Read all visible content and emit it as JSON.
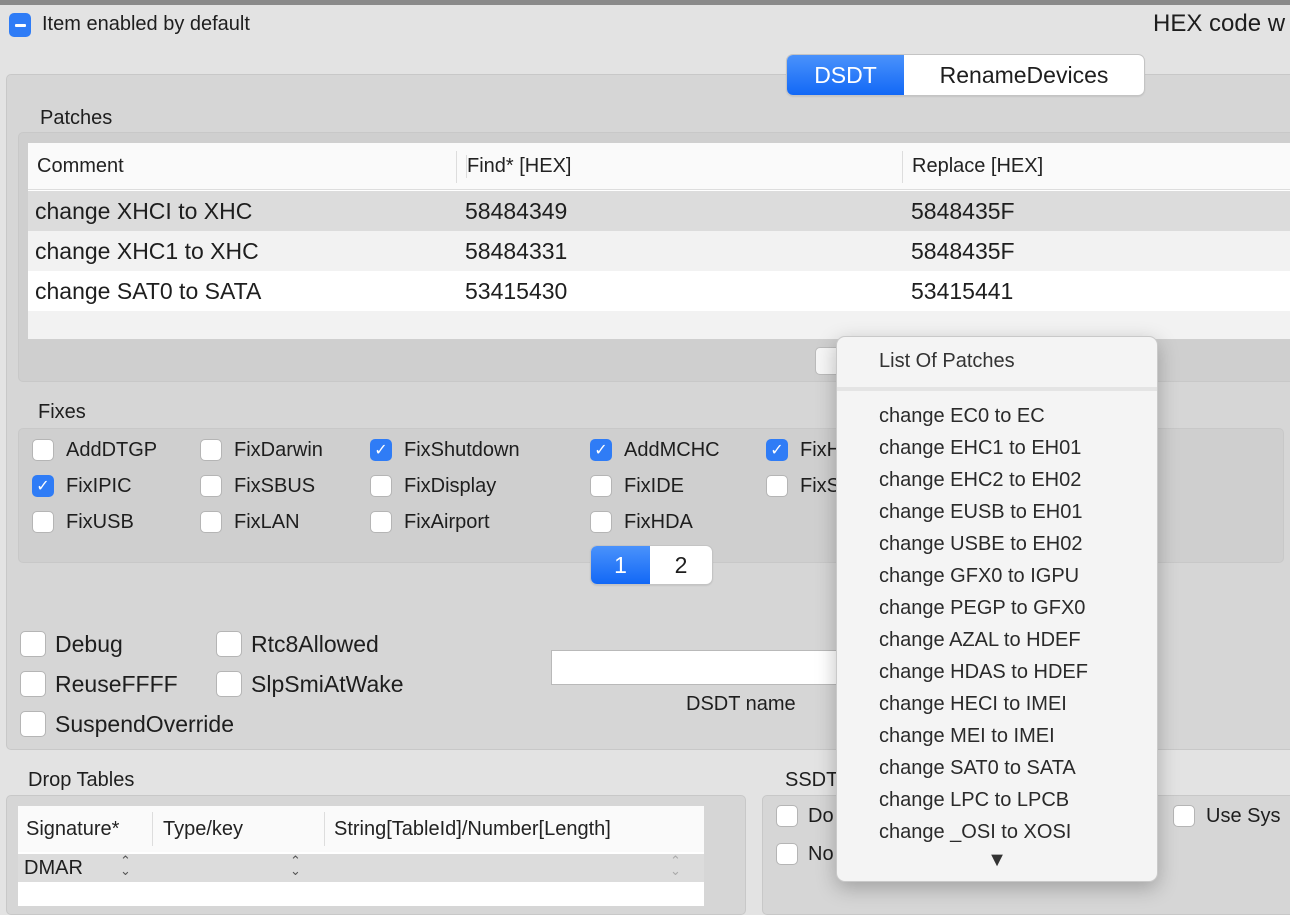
{
  "header": {
    "item_enabled_label": "Item enabled by default",
    "hex_code_label": "HEX code w"
  },
  "tabs": [
    {
      "label": "DSDT",
      "selected": true
    },
    {
      "label": "RenameDevices",
      "selected": false
    }
  ],
  "patches": {
    "title": "Patches",
    "columns": [
      "Comment",
      "Find* [HEX]",
      "Replace [HEX]"
    ],
    "rows": [
      {
        "comment": "change XHCI to XHC",
        "find": "58484349",
        "replace": "5848435F"
      },
      {
        "comment": "change XHC1 to XHC",
        "find": "58484331",
        "replace": "5848435F"
      },
      {
        "comment": "change SAT0 to SATA",
        "find": "53415430",
        "replace": "53415441"
      }
    ]
  },
  "fixes": {
    "title": "Fixes",
    "items": [
      {
        "label": "AddDTGP",
        "checked": false
      },
      {
        "label": "FixDarwin",
        "checked": false
      },
      {
        "label": "FixShutdown",
        "checked": true
      },
      {
        "label": "AddMCHC",
        "checked": true
      },
      {
        "label": "FixH",
        "checked": true
      },
      {
        "label": "FixIPIC",
        "checked": true
      },
      {
        "label": "FixSBUS",
        "checked": false
      },
      {
        "label": "FixDisplay",
        "checked": false
      },
      {
        "label": "FixIDE",
        "checked": false
      },
      {
        "label": "FixS",
        "checked": false
      },
      {
        "label": "FixUSB",
        "checked": false
      },
      {
        "label": "FixLAN",
        "checked": false
      },
      {
        "label": "FixAirport",
        "checked": false
      },
      {
        "label": "FixHDA",
        "checked": false
      }
    ],
    "pages": [
      "1",
      "2"
    ],
    "current_page": "1"
  },
  "options": [
    {
      "label": "Debug",
      "checked": false
    },
    {
      "label": "Rtc8Allowed",
      "checked": false
    },
    {
      "label": "ReuseFFFF",
      "checked": false
    },
    {
      "label": "SlpSmiAtWake",
      "checked": false
    },
    {
      "label": "SuspendOverride",
      "checked": false
    }
  ],
  "dsdt_name": {
    "label": "DSDT name",
    "value": ""
  },
  "drop_tables": {
    "title": "Drop Tables",
    "columns": [
      "Signature*",
      "Type/key",
      "String[TableId]/Number[Length]"
    ],
    "rows": [
      {
        "signature": "DMAR"
      }
    ]
  },
  "ssdt": {
    "title": "SSDT",
    "items": [
      "Do",
      "No"
    ],
    "use_sys_label": "Use Sys"
  },
  "popup": {
    "title": "List Of Patches",
    "items": [
      "change EC0 to EC",
      "change EHC1 to EH01",
      "change EHC2 to EH02",
      "change EUSB to EH01",
      "change USBE to EH02",
      "change GFX0 to IGPU",
      "change PEGP to GFX0",
      "change AZAL to HDEF",
      "change HDAS to HDEF",
      "change HECI to IMEI",
      "change MEI to IMEI",
      "change SAT0 to SATA",
      "change LPC to LPCB",
      "change _OSI to XOSI"
    ],
    "more_arrow": "▼"
  },
  "colors": {
    "accent": "#2f7cf6"
  }
}
